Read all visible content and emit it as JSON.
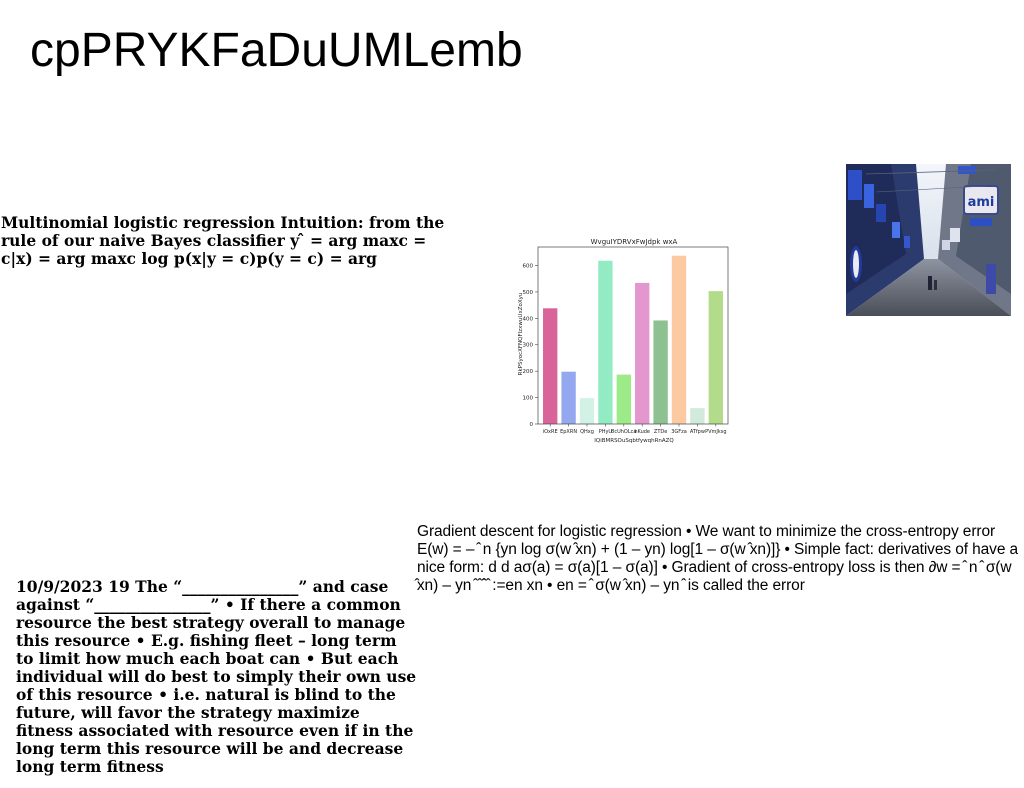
{
  "page": {
    "title": "cpPRYKFaDuUMLemb"
  },
  "blocks": {
    "top_left": "Multinomial logistic regression Intuition: from the rule of our naive Bayes classifier y ̂ = arg maxc = c|x) = arg maxc log p(x|y = c)p(y = c) = arg",
    "bottom_left": "10/9/2023 19 The “_______________” and case against “_______________” • If there a common resource the best strategy overall to manage this resource • E.g. fishing fleet – long term to limit how much each boat can • But each individual will do best to simply their own use of this resource • i.e. natural is blind to the future, will favor the strategy maximize fitness associated with resource even if in the long term this resource will be and decrease long term fitness",
    "right": "Gradient descent for logistic regression • We want to minimize the cross-entropy error E(w) = – ̂ n {yn log σ(w ̂xn) + (1 – yn) log[1 – σ(w ̂xn)]} • Simple fact: derivatives of have a nice form: d d aσ(a) = σ(a)[1 – σ(a)] • Gradient of cross-entropy loss is then ∂w = ̂ n ̂ σ(w ̂xn) – yn ̂ ̂ ̂̂ ̂ :=en xn • en = ̂ σ(w ̂xn) – yn ̂ is called the error"
  },
  "photo": {
    "icon": "street-photo-icon",
    "sign_text": "ami"
  },
  "chart_data": {
    "type": "bar",
    "title": "WvguIYDRVxFwJdpk wxA",
    "xlabel": "IQiBMRSOuSqbtfywqhRnAZQ",
    "ylabel": "RkPSyocXFNQFIzxwuUxZoXyu",
    "categories": [
      "iOxRE",
      "EpXRN",
      "QHxg",
      "PHyU",
      "8cUhOLca",
      "hKude",
      "ZTDe",
      "3GFza",
      "ATfpw",
      "PVmJksg"
    ],
    "values": [
      438,
      198,
      98,
      618,
      187,
      534,
      392,
      637,
      60,
      503
    ],
    "colors": [
      "#d9649a",
      "#94a8ef",
      "#d1f2e4",
      "#93ebc4",
      "#9deb88",
      "#e496cf",
      "#8dc192",
      "#fdc9a0",
      "#d1eadb",
      "#b3dc8a"
    ],
    "yticks": [
      0,
      100,
      200,
      300,
      400,
      500,
      600
    ],
    "ylim": [
      0,
      670
    ],
    "grid": false,
    "legend": "none"
  }
}
